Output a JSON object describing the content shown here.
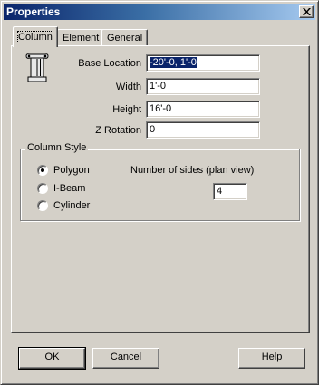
{
  "window": {
    "title": "Properties"
  },
  "tabs": [
    {
      "label": "Column",
      "active": true
    },
    {
      "label": "Element",
      "active": false
    },
    {
      "label": "General",
      "active": false
    }
  ],
  "icons": {
    "column": "column-icon",
    "close": "close-icon"
  },
  "fields": {
    "base_location": {
      "label": "Base Location",
      "value": "-20'-0, 1'-0"
    },
    "width": {
      "label": "Width",
      "value": "1'-0"
    },
    "height": {
      "label": "Height",
      "value": "16'-0"
    },
    "z_rotation": {
      "label": "Z Rotation",
      "value": "0"
    }
  },
  "column_style": {
    "label": "Column Style",
    "options": [
      {
        "label": "Polygon",
        "checked": true
      },
      {
        "label": "I-Beam",
        "checked": false
      },
      {
        "label": "Cylinder",
        "checked": false
      }
    ],
    "sides_label": "Number of sides (plan view)",
    "sides_value": "4"
  },
  "buttons": {
    "ok": "OK",
    "cancel": "Cancel",
    "help": "Help"
  },
  "colors": {
    "title_bar": "#0a246a",
    "face": "#d4d0c8",
    "selection": "#0a246a"
  }
}
